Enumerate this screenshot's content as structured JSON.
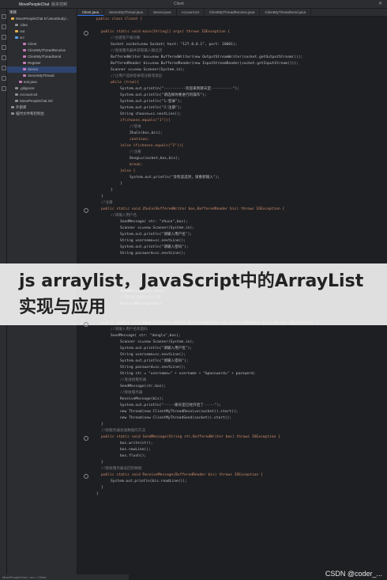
{
  "titlebar": {
    "project_name": "MovePeopleChat",
    "branch": "版本控制",
    "window_title": "Client"
  },
  "project_panel": {
    "header": "项目",
    "items": [
      {
        "label": "MovePeopleChat  D:\\JavaStudy\\..."
      },
      {
        "label": ".idea"
      },
      {
        "label": "out"
      },
      {
        "label": "src"
      },
      {
        "label": "Client"
      },
      {
        "label": "ClientMyThreadReceive"
      },
      {
        "label": "ClientMyThreadSend"
      },
      {
        "label": "Register"
      },
      {
        "label": "Server"
      },
      {
        "label": "ServerMyThread"
      },
      {
        "label": "test.java"
      },
      {
        "label": ".gitignore"
      },
      {
        "label": "Account.txt"
      },
      {
        "label": "MovePeopleChat.iml"
      },
      {
        "label": "外部库"
      },
      {
        "label": "临时文件和控制台"
      }
    ]
  },
  "tabs": [
    {
      "label": "Client.java"
    },
    {
      "label": "ServerMyThread.java"
    },
    {
      "label": "Server.java"
    },
    {
      "label": "Account.txt"
    },
    {
      "label": "ClientMyThreadReceive.java"
    },
    {
      "label": "ClientMyThreadSend.java"
    }
  ],
  "code_lines": [
    {
      "t": "public class Client {",
      "c": "kw",
      "i": 0
    },
    {
      "t": "",
      "c": "pl",
      "i": 0
    },
    {
      "t": "public static void main(String[] args) throws IOException {",
      "c": "kw",
      "i": 1
    },
    {
      "t": "//创建客户端对象",
      "c": "cm",
      "i": 2
    },
    {
      "t": "Socket socket=new Socket( host: \"127.0.0.1\", port: 10001);",
      "c": "pl",
      "i": 2
    },
    {
      "t": "//连接服务器并获取输入输出流",
      "c": "cm",
      "i": 2
    },
    {
      "t": "BufferedWriter bos=new BufferedWriter(new OutputStreamWriter(socket.getOutputStream()));",
      "c": "pl",
      "i": 2
    },
    {
      "t": "BufferedReader bis=new BufferedReader(new InputStreamReader(socket.getInputStream()));",
      "c": "pl",
      "i": 2
    },
    {
      "t": "Scanner sc=new Scanner(System.in);",
      "c": "pl",
      "i": 2
    },
    {
      "t": "//让用户选择登录或注册或退出",
      "c": "cm",
      "i": 2
    },
    {
      "t": "while (true){",
      "c": "kw",
      "i": 2
    },
    {
      "t": "System.out.println(\"----------欢迎来到聊天室----------\");",
      "c": "pl",
      "i": 3
    },
    {
      "t": "System.out.println(\"请选择你要进行的操作\");",
      "c": "pl",
      "i": 3
    },
    {
      "t": "System.out.println(\"1:登录\");",
      "c": "pl",
      "i": 3
    },
    {
      "t": "System.out.println(\"2:注册\");",
      "c": "pl",
      "i": 3
    },
    {
      "t": "String choose=sc.nextLine();",
      "c": "pl",
      "i": 3
    },
    {
      "t": "if(choose.equals(\"1\")){",
      "c": "kw",
      "i": 3
    },
    {
      "t": "//登录",
      "c": "cm",
      "i": 4
    },
    {
      "t": "ZhuCe(bos,bis);",
      "c": "pl",
      "i": 4
    },
    {
      "t": "continue;",
      "c": "kw",
      "i": 4
    },
    {
      "t": "}else if(choose.equals(\"2\")){",
      "c": "kw",
      "i": 3
    },
    {
      "t": "//注册",
      "c": "cm",
      "i": 4
    },
    {
      "t": "DengLu(socket,bos,bis);",
      "c": "pl",
      "i": 4
    },
    {
      "t": "break;",
      "c": "kw",
      "i": 4
    },
    {
      "t": "}else {",
      "c": "kw",
      "i": 3
    },
    {
      "t": "System.out.println(\"没有该选项，请重新输入\");",
      "c": "pl",
      "i": 4
    },
    {
      "t": "}",
      "c": "pl",
      "i": 3
    },
    {
      "t": "}",
      "c": "pl",
      "i": 2
    },
    {
      "t": "}",
      "c": "pl",
      "i": 1
    },
    {
      "t": "//注册",
      "c": "cm",
      "i": 1
    },
    {
      "t": "public static void ZhuCe(BufferedWriter bos,BufferedReader bis) throws IOException {",
      "c": "kw",
      "i": 1
    },
    {
      "t": "//请输入用户名",
      "c": "cm",
      "i": 2
    },
    {
      "t": "SendMessage( str: \"zhuce\",bos);",
      "c": "pl",
      "i": 3
    },
    {
      "t": "Scanner sc=new Scanner(System.in);",
      "c": "pl",
      "i": 3
    },
    {
      "t": "System.out.println(\"请输入用户名\");",
      "c": "pl",
      "i": 3
    },
    {
      "t": "String username=sc.nextLine();",
      "c": "pl",
      "i": 3
    },
    {
      "t": "System.out.println(\"请输入密码\");",
      "c": "pl",
      "i": 3
    },
    {
      "t": "String password=sc.nextLine();",
      "c": "pl",
      "i": 3
    },
    {
      "t": "",
      "c": "pl",
      "i": 0
    },
    {
      "t": "",
      "c": "pl",
      "i": 0
    },
    {
      "t": "",
      "c": "pl",
      "i": 0
    },
    {
      "t": "",
      "c": "pl",
      "i": 0
    },
    {
      "t": "",
      "c": "pl",
      "i": 0
    },
    {
      "t": "SendMessage(str,bos);",
      "c": "pl",
      "i": 3
    },
    {
      "t": "//获取服务器的返回信息",
      "c": "cm",
      "i": 3
    },
    {
      "t": "ReceiveMessage(bis);",
      "c": "pl",
      "i": 3
    },
    {
      "t": "}",
      "c": "pl",
      "i": 1
    },
    {
      "t": "",
      "c": "pl",
      "i": 0
    },
    {
      "t": "public static void DengLu(Socket socket,BufferedWriter bos,BufferedReader bis) throws IOException {",
      "c": "kw",
      "i": 1
    },
    {
      "t": "//请输入用户名和密码",
      "c": "cm",
      "i": 2
    },
    {
      "t": "SendMessage( str: \"denglu\",bos);",
      "c": "pl",
      "i": 2
    },
    {
      "t": "Scanner sc=new Scanner(System.in);",
      "c": "pl",
      "i": 3
    },
    {
      "t": "System.out.println(\"请输入用户名\");",
      "c": "pl",
      "i": 3
    },
    {
      "t": "String username=sc.nextLine();",
      "c": "pl",
      "i": 3
    },
    {
      "t": "System.out.println(\"请输入密码\");",
      "c": "pl",
      "i": 3
    },
    {
      "t": "String password=sc.nextLine();",
      "c": "pl",
      "i": 3
    },
    {
      "t": "String str = \"username=\" + username + \"&password=\" + password;",
      "c": "pl",
      "i": 3
    },
    {
      "t": "//发送给服务器",
      "c": "cm",
      "i": 3
    },
    {
      "t": "SendMessage(str,bos);",
      "c": "pl",
      "i": 3
    },
    {
      "t": "//接收服务器",
      "c": "cm",
      "i": 3
    },
    {
      "t": "ReceiveMessage(bis);",
      "c": "pl",
      "i": 3
    },
    {
      "t": "System.out.println(\"-----聊天室已经开启了-----\");",
      "c": "pl",
      "i": 3
    },
    {
      "t": "new Thread(new ClientMyThreadReceive(socket)).start();",
      "c": "pl",
      "i": 3
    },
    {
      "t": "new Thread(new ClientMyThreadSend(socket)).start();",
      "c": "pl",
      "i": 3
    },
    {
      "t": "}",
      "c": "pl",
      "i": 1
    },
    {
      "t": "//给服务器发送数据的方法",
      "c": "cm",
      "i": 1
    },
    {
      "t": "public static void SendMessage(String str,BufferedWriter bos) throws IOException {",
      "c": "kw",
      "i": 1
    },
    {
      "t": "bos.write(str);",
      "c": "pl",
      "i": 3
    },
    {
      "t": "bos.newLine();",
      "c": "pl",
      "i": 3
    },
    {
      "t": "bos.flush();",
      "c": "pl",
      "i": 3
    },
    {
      "t": "}",
      "c": "pl",
      "i": 1
    },
    {
      "t": "//接收服务器返回的数据",
      "c": "cm",
      "i": 1
    },
    {
      "t": "public static void ReceiveMessage(BufferedReader bis) throws IOException {",
      "c": "kw",
      "i": 1
    },
    {
      "t": "System.out.println(bis.readLine());",
      "c": "pl",
      "i": 2
    },
    {
      "t": "}",
      "c": "pl",
      "i": 1
    },
    {
      "t": "}",
      "c": "pl",
      "i": 0
    }
  ],
  "overlay_title": "js arraylist，JavaScript中的ArrayList实现与应用",
  "watermark": "CSDN @coder_...",
  "statusbar": "MovePeopleChat > src > Client"
}
